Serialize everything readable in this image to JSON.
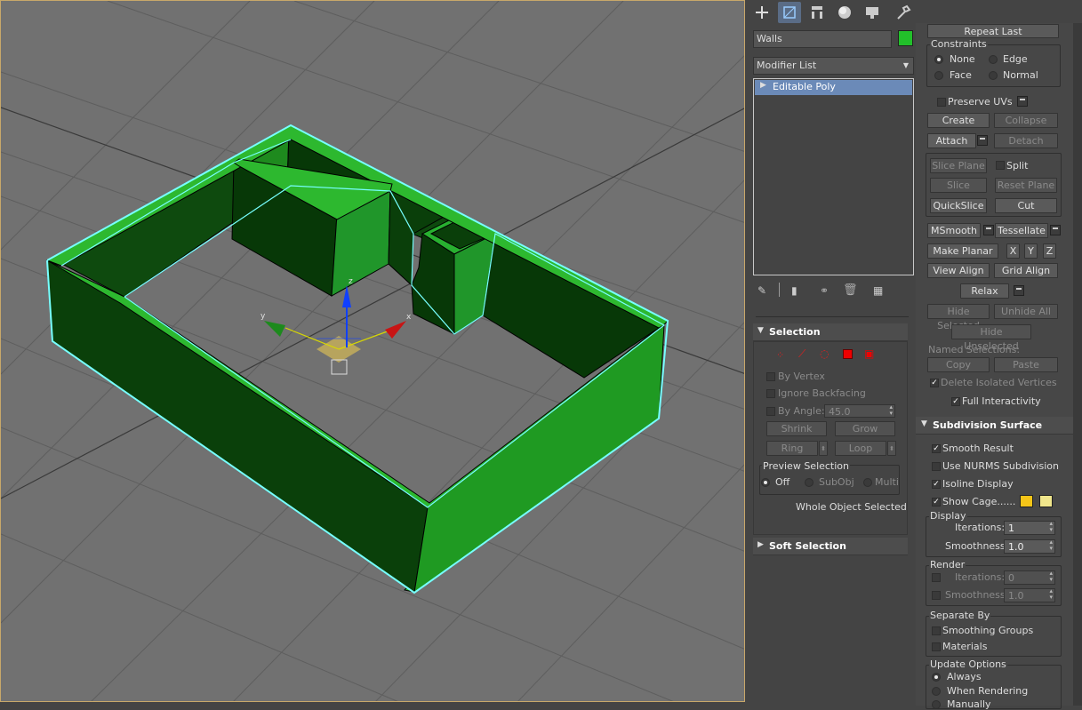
{
  "tabs": [
    "create-icon",
    "modify-icon",
    "hierarchy-icon",
    "motion-icon",
    "display-icon",
    "utilities-icon"
  ],
  "object": {
    "name": "Walls",
    "color": "#22c02a"
  },
  "modifier_list": {
    "label": "Modifier List",
    "stack_item": "Editable Poly"
  },
  "selection": {
    "title": "Selection",
    "by_vertex": "By Vertex",
    "ignore_backfacing": "Ignore Backfacing",
    "by_angle": "By Angle:",
    "angle_value": "45.0",
    "shrink": "Shrink",
    "grow": "Grow",
    "ring": "Ring",
    "loop": "Loop",
    "preview_title": "Preview Selection",
    "preview_off": "Off",
    "preview_subobj": "SubObj",
    "preview_multi": "Multi",
    "status": "Whole Object Selected"
  },
  "soft_selection": {
    "title": "Soft Selection"
  },
  "edit_geometry": {
    "repeat_last": "Repeat Last",
    "constraints": "Constraints",
    "c_none": "None",
    "c_edge": "Edge",
    "c_face": "Face",
    "c_normal": "Normal",
    "preserve_uvs": "Preserve UVs",
    "create": "Create",
    "collapse": "Collapse",
    "attach": "Attach",
    "detach": "Detach",
    "slice_plane": "Slice Plane",
    "split": "Split",
    "slice": "Slice",
    "reset_plane": "Reset Plane",
    "quickslice": "QuickSlice",
    "cut": "Cut",
    "msmooth": "MSmooth",
    "tessellate": "Tessellate",
    "make_planar": "Make Planar",
    "x": "X",
    "y": "Y",
    "z": "Z",
    "view_align": "View Align",
    "grid_align": "Grid Align",
    "relax": "Relax",
    "hide_selected": "Hide Selected",
    "unhide_all": "Unhide All",
    "hide_unselected": "Hide Unselected",
    "named_selections": "Named Selections:",
    "copy": "Copy",
    "paste": "Paste",
    "delete_isolated": "Delete Isolated Vertices",
    "full_interactivity": "Full Interactivity"
  },
  "subdivision": {
    "title": "Subdivision Surface",
    "smooth_result": "Smooth Result",
    "use_nurms": "Use NURMS Subdivision",
    "isoline": "Isoline Display",
    "show_cage": "Show Cage......",
    "cage_color1": "#f5c518",
    "cage_color2": "#f0e68c",
    "display": "Display",
    "iterations": "Iterations:",
    "iter_val": "1",
    "smoothness": "Smoothness:",
    "smooth_val": "1.0",
    "render": "Render",
    "r_iterations": "Iterations:",
    "r_iter_val": "0",
    "r_smoothness": "Smoothness:",
    "r_smooth_val": "1.0",
    "separate_by": "Separate By",
    "smoothing_groups": "Smoothing Groups",
    "materials": "Materials",
    "update_options": "Update Options",
    "always": "Always",
    "when_rendering": "When Rendering",
    "manually": "Manually"
  },
  "gizmo": {
    "x": "x",
    "y": "y",
    "z": "z"
  }
}
